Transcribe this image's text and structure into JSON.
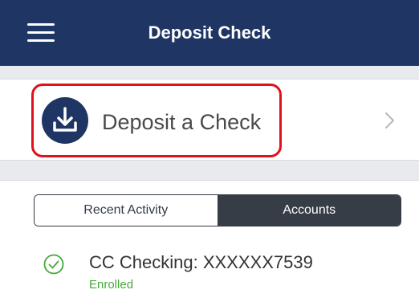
{
  "header": {
    "title": "Deposit Check",
    "menu_icon": "hamburger-menu-icon",
    "background_color": "#1f3563"
  },
  "deposit_action": {
    "label": "Deposit a Check",
    "icon": "download-tray-icon",
    "chevron_icon": "chevron-right-icon",
    "highlight_color": "#e0101c"
  },
  "tabs": [
    {
      "label": "Recent Activity",
      "selected": false
    },
    {
      "label": "Accounts",
      "selected": true
    }
  ],
  "accounts": [
    {
      "name": "CC Checking: XXXXXX7539",
      "status": "Enrolled",
      "status_color": "#46a83a",
      "icon": "check-circle-icon"
    }
  ]
}
